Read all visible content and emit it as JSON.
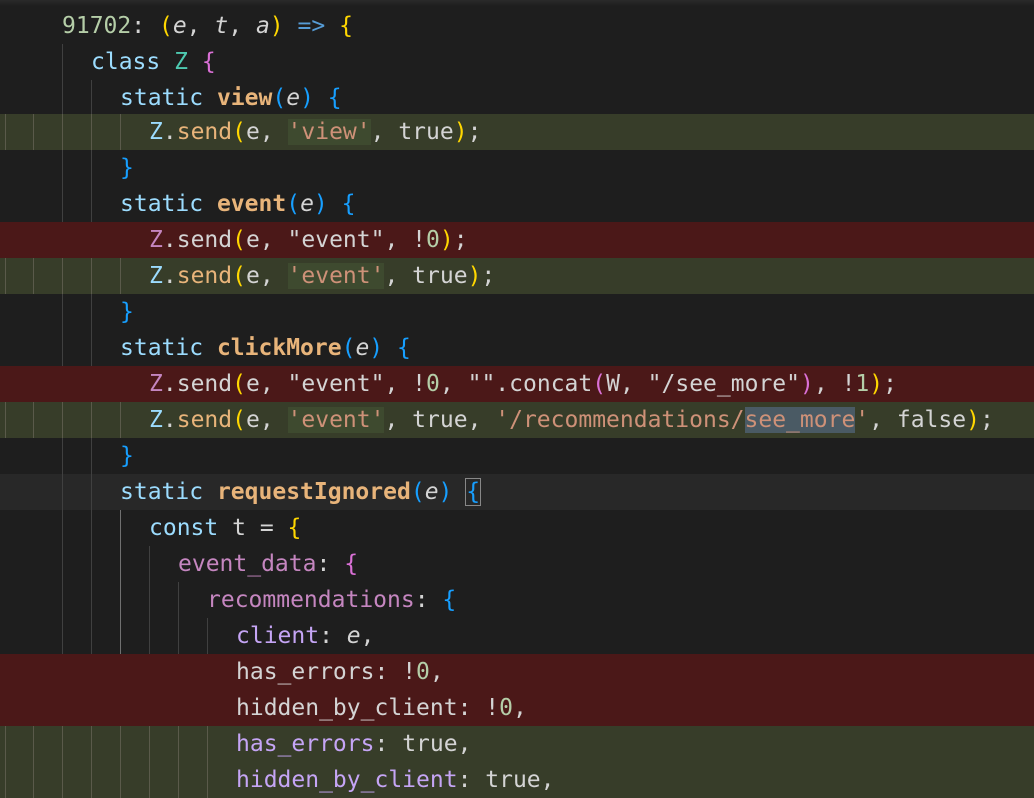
{
  "lines": [
    {
      "id": "l0",
      "kind": "normal",
      "text": "91702: (e, t, a) => {"
    },
    {
      "id": "l1",
      "kind": "normal",
      "text": "class Z {"
    },
    {
      "id": "l2",
      "kind": "normal",
      "text": "static view(e) {"
    },
    {
      "id": "l3",
      "kind": "added",
      "text": "Z.send(e, 'view', true);"
    },
    {
      "id": "l4",
      "kind": "normal",
      "text": "}"
    },
    {
      "id": "l5",
      "kind": "normal",
      "text": "static event(e) {"
    },
    {
      "id": "l6",
      "kind": "removed",
      "text": "Z.send(e, \"event\", !0);"
    },
    {
      "id": "l7",
      "kind": "added",
      "text": "Z.send(e, 'event', true);"
    },
    {
      "id": "l8",
      "kind": "normal",
      "text": "}"
    },
    {
      "id": "l9",
      "kind": "normal",
      "text": "static clickMore(e) {"
    },
    {
      "id": "l10",
      "kind": "removed",
      "text": "Z.send(e, \"event\", !0, \"\".concat(W, \"/see_more\"), !1);"
    },
    {
      "id": "l11",
      "kind": "added",
      "text": "Z.send(e, 'event', true, '/recommendations/see_more', false);"
    },
    {
      "id": "l12",
      "kind": "normal",
      "text": "}"
    },
    {
      "id": "l13",
      "kind": "current",
      "text": "static requestIgnored(e) {"
    },
    {
      "id": "l14",
      "kind": "normal",
      "text": "const t = {"
    },
    {
      "id": "l15",
      "kind": "normal",
      "text": "event_data: {"
    },
    {
      "id": "l16",
      "kind": "normal",
      "text": "recommendations: {"
    },
    {
      "id": "l17",
      "kind": "normal",
      "text": "client: e,"
    },
    {
      "id": "l18",
      "kind": "removed",
      "text": "has_errors: !0,"
    },
    {
      "id": "l19",
      "kind": "removed",
      "text": "hidden_by_client: !0,"
    },
    {
      "id": "l20",
      "kind": "added",
      "text": "has_errors: true,"
    },
    {
      "id": "l21",
      "kind": "added",
      "text": "hidden_by_client: true,"
    }
  ],
  "tokens": {
    "module_id": "91702",
    "class_keyword": "class",
    "class_name": "Z",
    "static_keyword": "static",
    "method_view": "view",
    "method_event": "event",
    "method_click_more": "clickMore",
    "method_request_ignored": "requestIgnored",
    "send": "send",
    "param_e": "e",
    "param_t": "t",
    "param_a": "a",
    "arrow": "=>",
    "str_view": "'view'",
    "str_event_dq": "\"event\"",
    "str_event_sq": "'event'",
    "str_empty": "\"\"",
    "concat": "concat",
    "var_w": "W",
    "str_see_more_dq": "\"/see_more\"",
    "str_path_prefix": "'/recommendations/",
    "str_path_sel": "see_more",
    "str_path_end": "'",
    "true_kw": "true",
    "false_kw": "false",
    "not_zero": "!0",
    "not_one": "!1",
    "const_kw": "const",
    "event_data": "event_data",
    "recommendations": "recommendations",
    "client": "client",
    "has_errors": "has_errors",
    "hidden_by_client": "hidden_by_client"
  },
  "colors": {
    "background": "#1e1e1e",
    "added_line": "#373d29",
    "removed_line": "#4b1818",
    "current_line": "#282828"
  }
}
